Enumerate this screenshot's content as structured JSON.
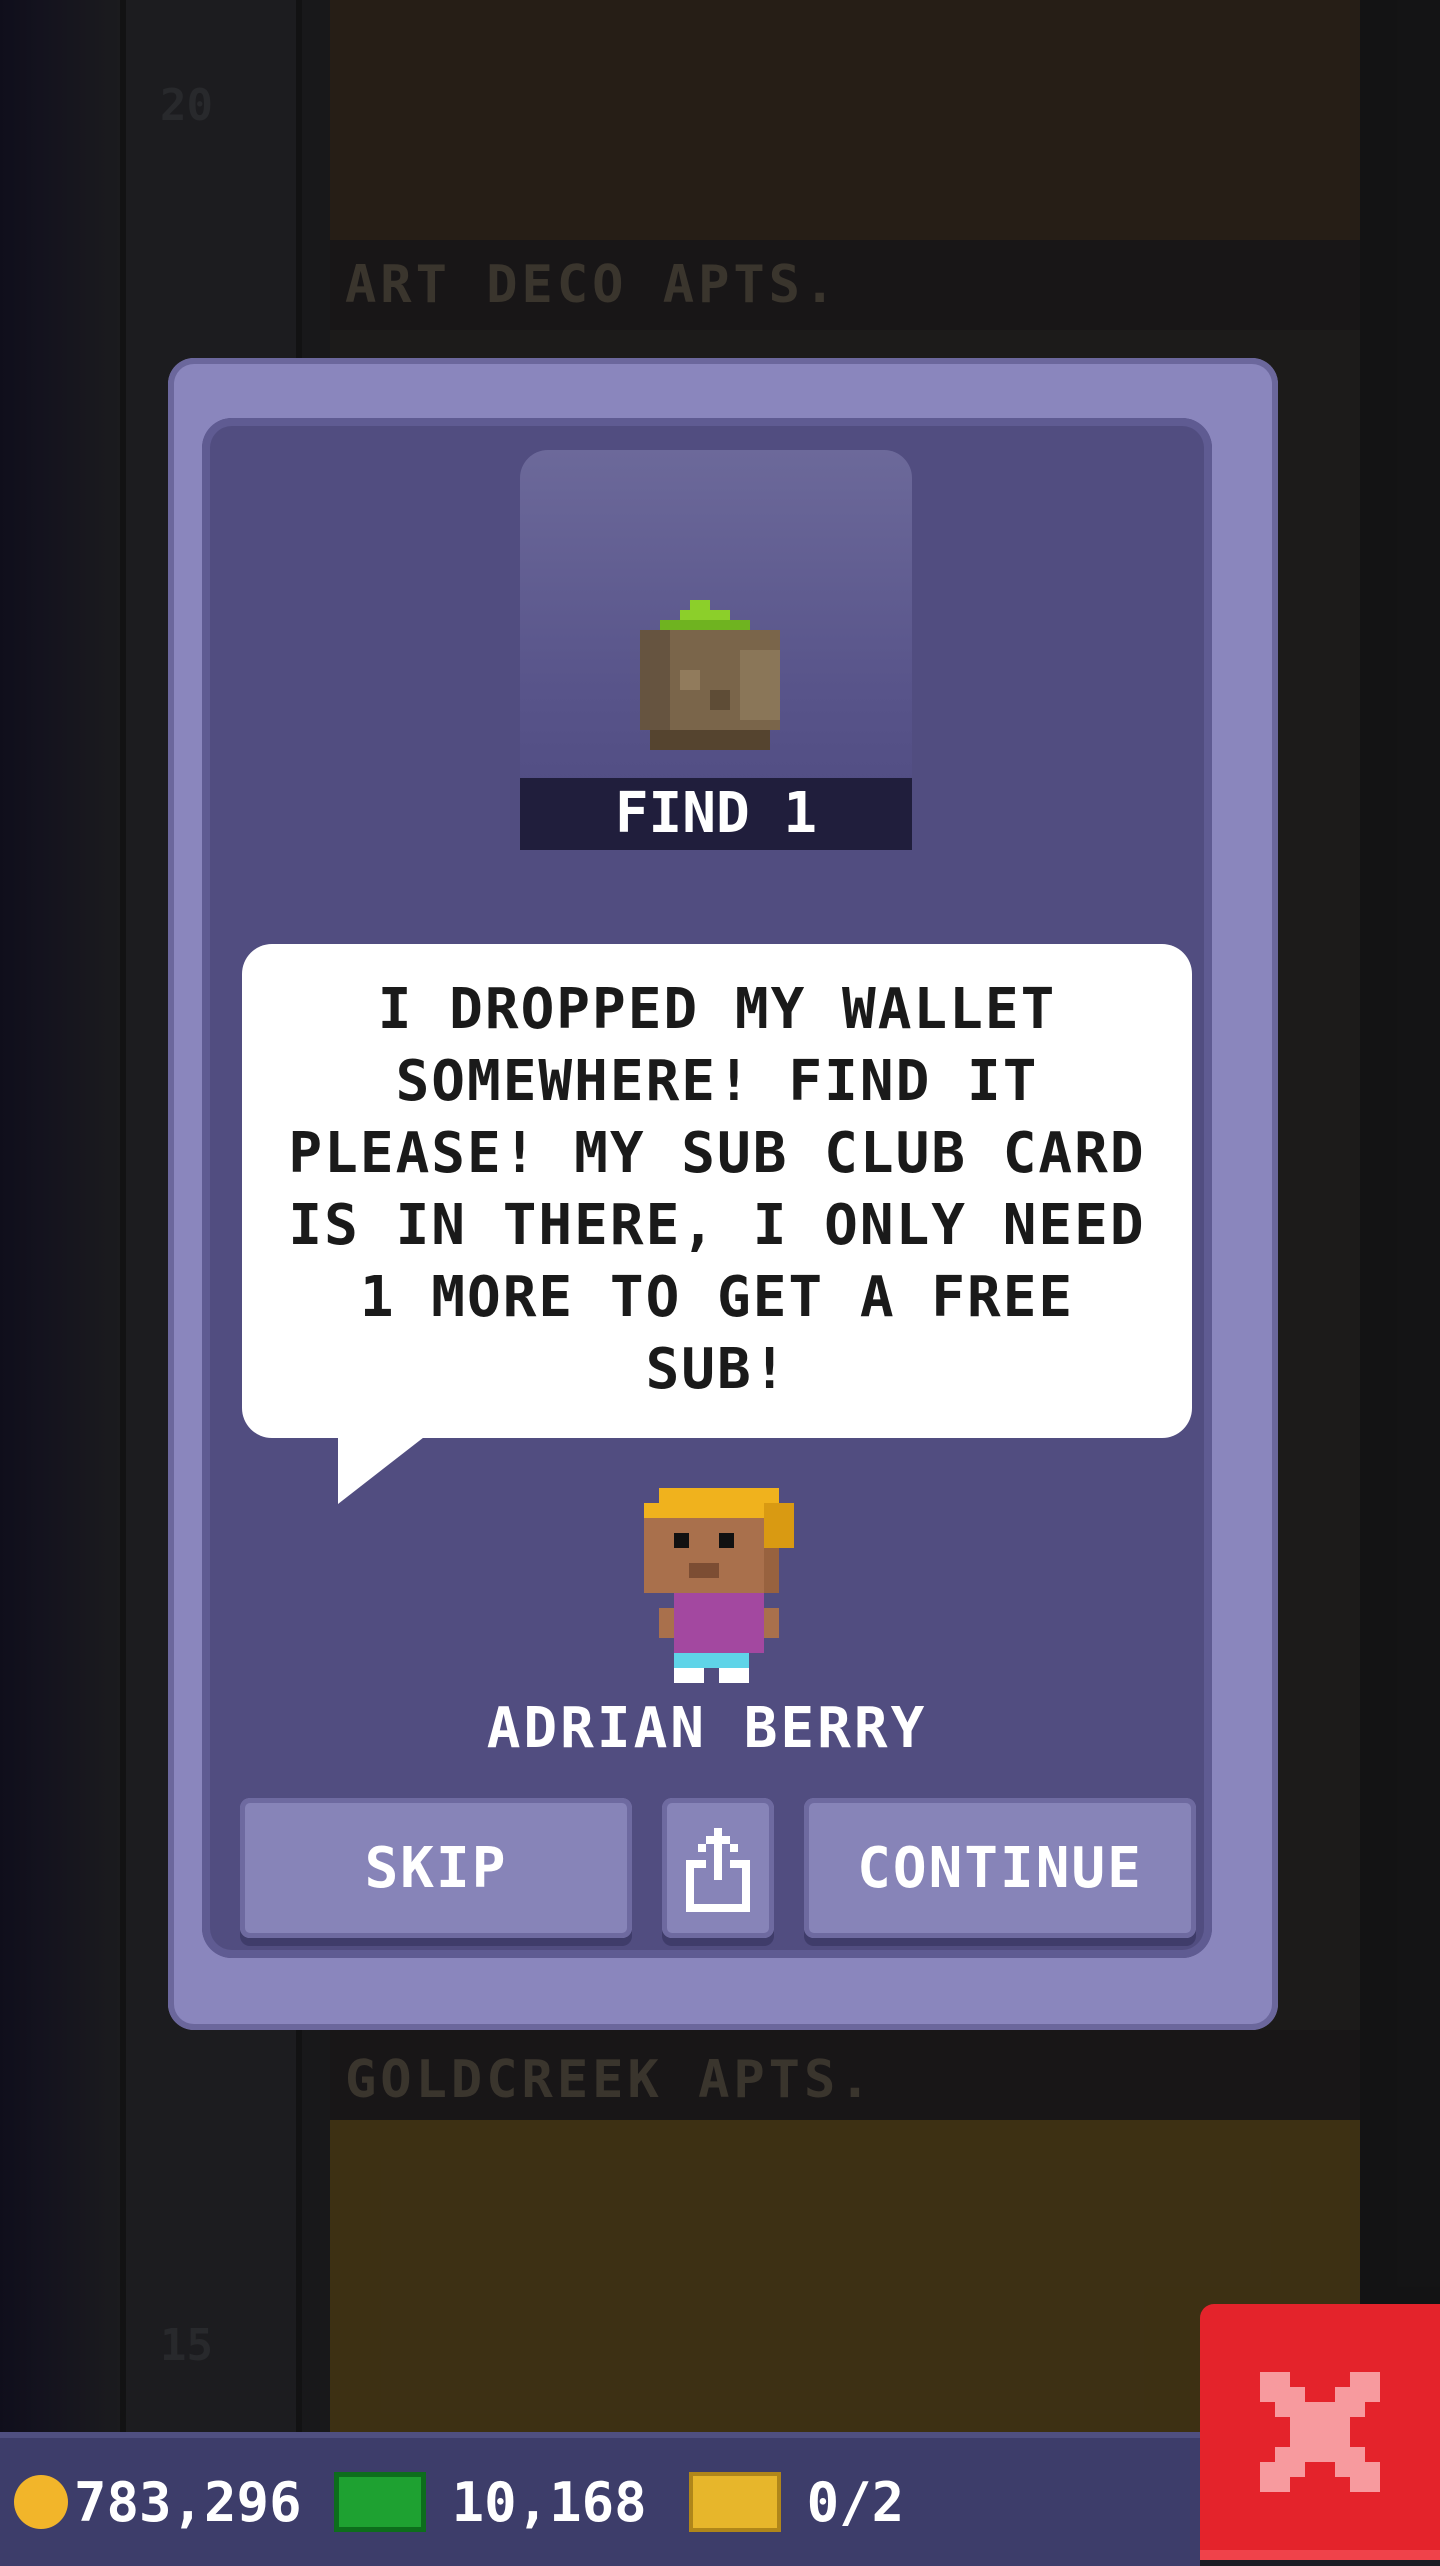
{
  "background": {
    "floor_top_sign": "ART DECO APTS.",
    "floor_bottom_sign": "GOLDCREEK APTS.",
    "floor_number_top": "20",
    "floor_number_bottom": "15"
  },
  "quest": {
    "item_icon": "potted-plant-icon",
    "label": "FIND 1",
    "message": "I DROPPED MY WALLET SOMEWHERE! FIND IT PLEASE! MY SUB CLUB CARD IS IN THERE, I ONLY NEED 1 MORE TO GET A FREE SUB!",
    "npc_name": "ADRIAN BERRY"
  },
  "buttons": {
    "skip": "SKIP",
    "share_icon": "share-icon",
    "continue": "CONTINUE"
  },
  "hud": {
    "coins": "783,296",
    "bux": "10,168",
    "tickets": "0/2"
  },
  "colors": {
    "dialog": "#8a86bd",
    "dialog_inner": "#514d80",
    "close": "#e4232b",
    "coin": "#f2b52a",
    "cash": "#1ea131",
    "ticket": "#e7b62b"
  }
}
